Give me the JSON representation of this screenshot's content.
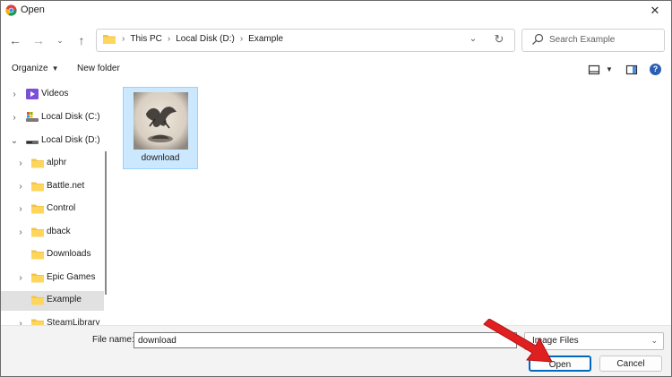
{
  "window": {
    "title": "Open"
  },
  "address_bar": {
    "crumbs": [
      "This PC",
      "Local Disk (D:)",
      "Example"
    ]
  },
  "search": {
    "placeholder": "Search Example"
  },
  "command_bar": {
    "organize": "Organize",
    "new_folder": "New folder"
  },
  "nav_tree": [
    {
      "label": "Videos",
      "icon": "videos-icon",
      "expander": "collapsed"
    },
    {
      "label": "Local Disk (C:)",
      "icon": "drive-c-icon",
      "expander": "collapsed"
    },
    {
      "label": "Local Disk (D:)",
      "icon": "drive-d-icon",
      "expander": "expanded"
    },
    {
      "label": "alphr",
      "icon": "folder-icon",
      "expander": "collapsed"
    },
    {
      "label": "Battle.net",
      "icon": "folder-icon",
      "expander": "collapsed"
    },
    {
      "label": "Control",
      "icon": "folder-icon",
      "expander": "collapsed"
    },
    {
      "label": "dback",
      "icon": "folder-icon",
      "expander": "collapsed"
    },
    {
      "label": "Downloads",
      "icon": "folder-icon",
      "expander": "none"
    },
    {
      "label": "Epic Games",
      "icon": "folder-icon",
      "expander": "collapsed"
    },
    {
      "label": "Example",
      "icon": "folder-icon",
      "expander": "none",
      "selected": true
    },
    {
      "label": "SteamLibrary",
      "icon": "folder-icon",
      "expander": "collapsed"
    }
  ],
  "files": [
    {
      "name": "download",
      "selected": true
    }
  ],
  "bottom": {
    "file_name_label": "File name:",
    "file_name_value": "download",
    "file_type": "Image Files",
    "open_label": "Open",
    "cancel_label": "Cancel"
  },
  "colors": {
    "accent": "#0067c0",
    "selection": "#cce8ff",
    "annotation_arrow": "#e02020"
  }
}
